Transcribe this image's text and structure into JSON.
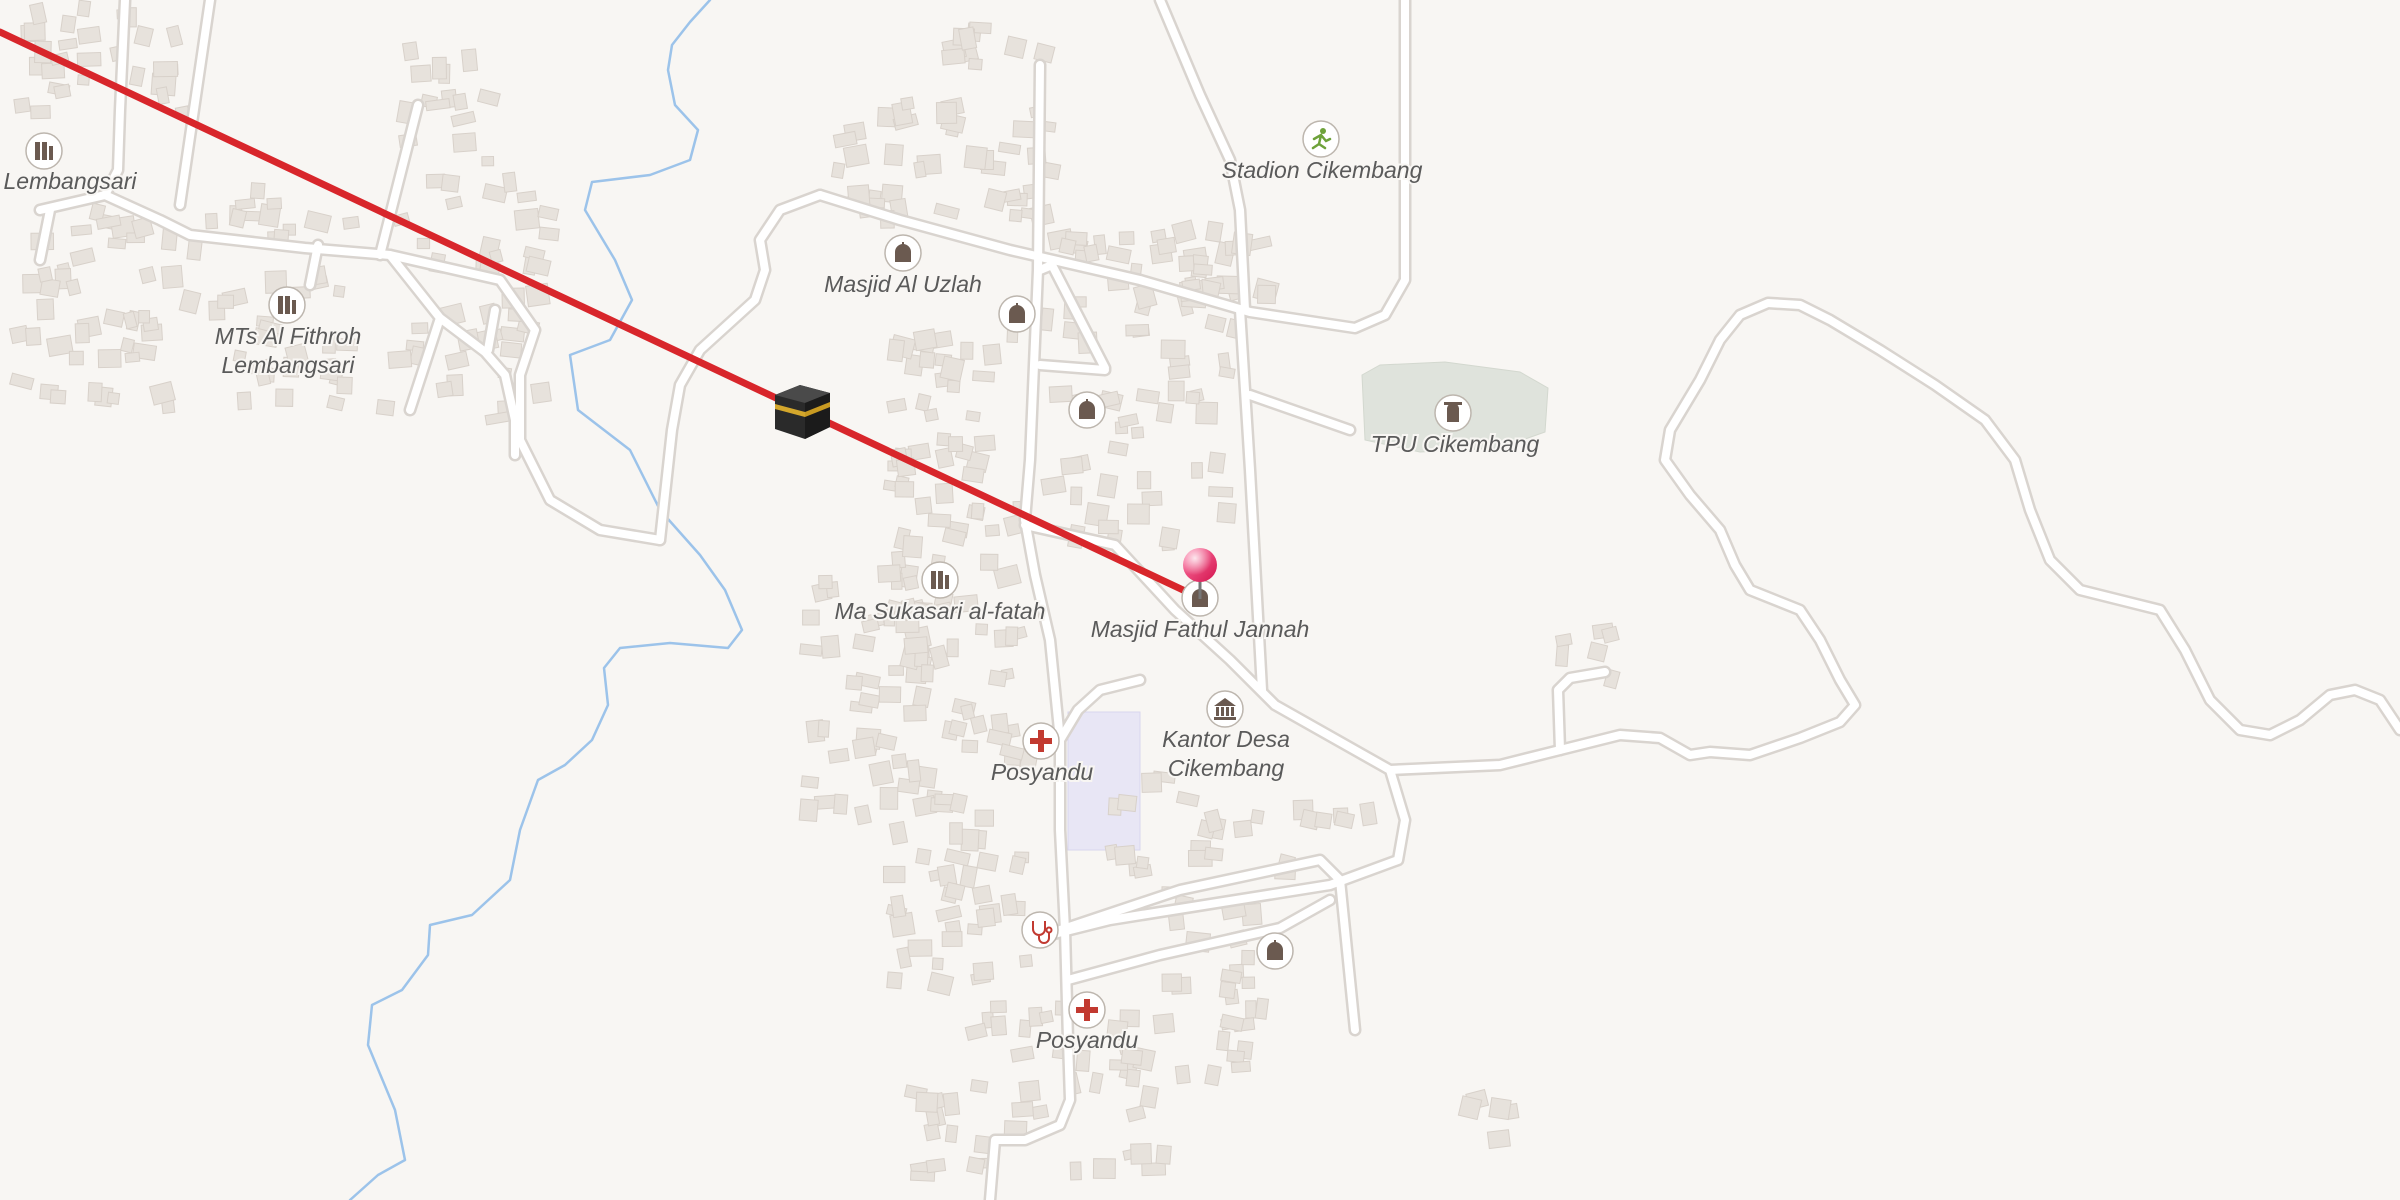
{
  "map": {
    "places": {
      "lembangsari": "Lembangsari",
      "mts": "MTs Al Fithroh",
      "mts2": "Lembangsari",
      "uzlah": "Masjid Al Uzlah",
      "stadion": "Stadion Cikembang",
      "tpu": "TPU Cikembang",
      "sukasari": "Ma Sukasari al-fatah",
      "fathul": "Masjid Fathul Jannah",
      "kantor": "Kantor Desa",
      "kantor2": "Cikembang",
      "posyandu1": "Posyandu",
      "posyandu2": "Posyandu"
    },
    "colors": {
      "background": "#f8f6f3",
      "qibla_line": "#d8262b",
      "pin": "#e8185a",
      "water": "#9cc3ea",
      "building": "#e7e2dc",
      "cemetery": "#dfe3dc",
      "school": "#e8e6f5",
      "poi_icon": "#6b5a50",
      "health_icon": "#c23a31",
      "sport_icon": "#6ea23a"
    },
    "icons": [
      "school-icon",
      "mosque-icon",
      "sport-icon",
      "cemetery-icon",
      "townhall-icon",
      "health-cross-icon",
      "doctor-icon",
      "kaaba-icon",
      "location-pin-icon"
    ]
  }
}
